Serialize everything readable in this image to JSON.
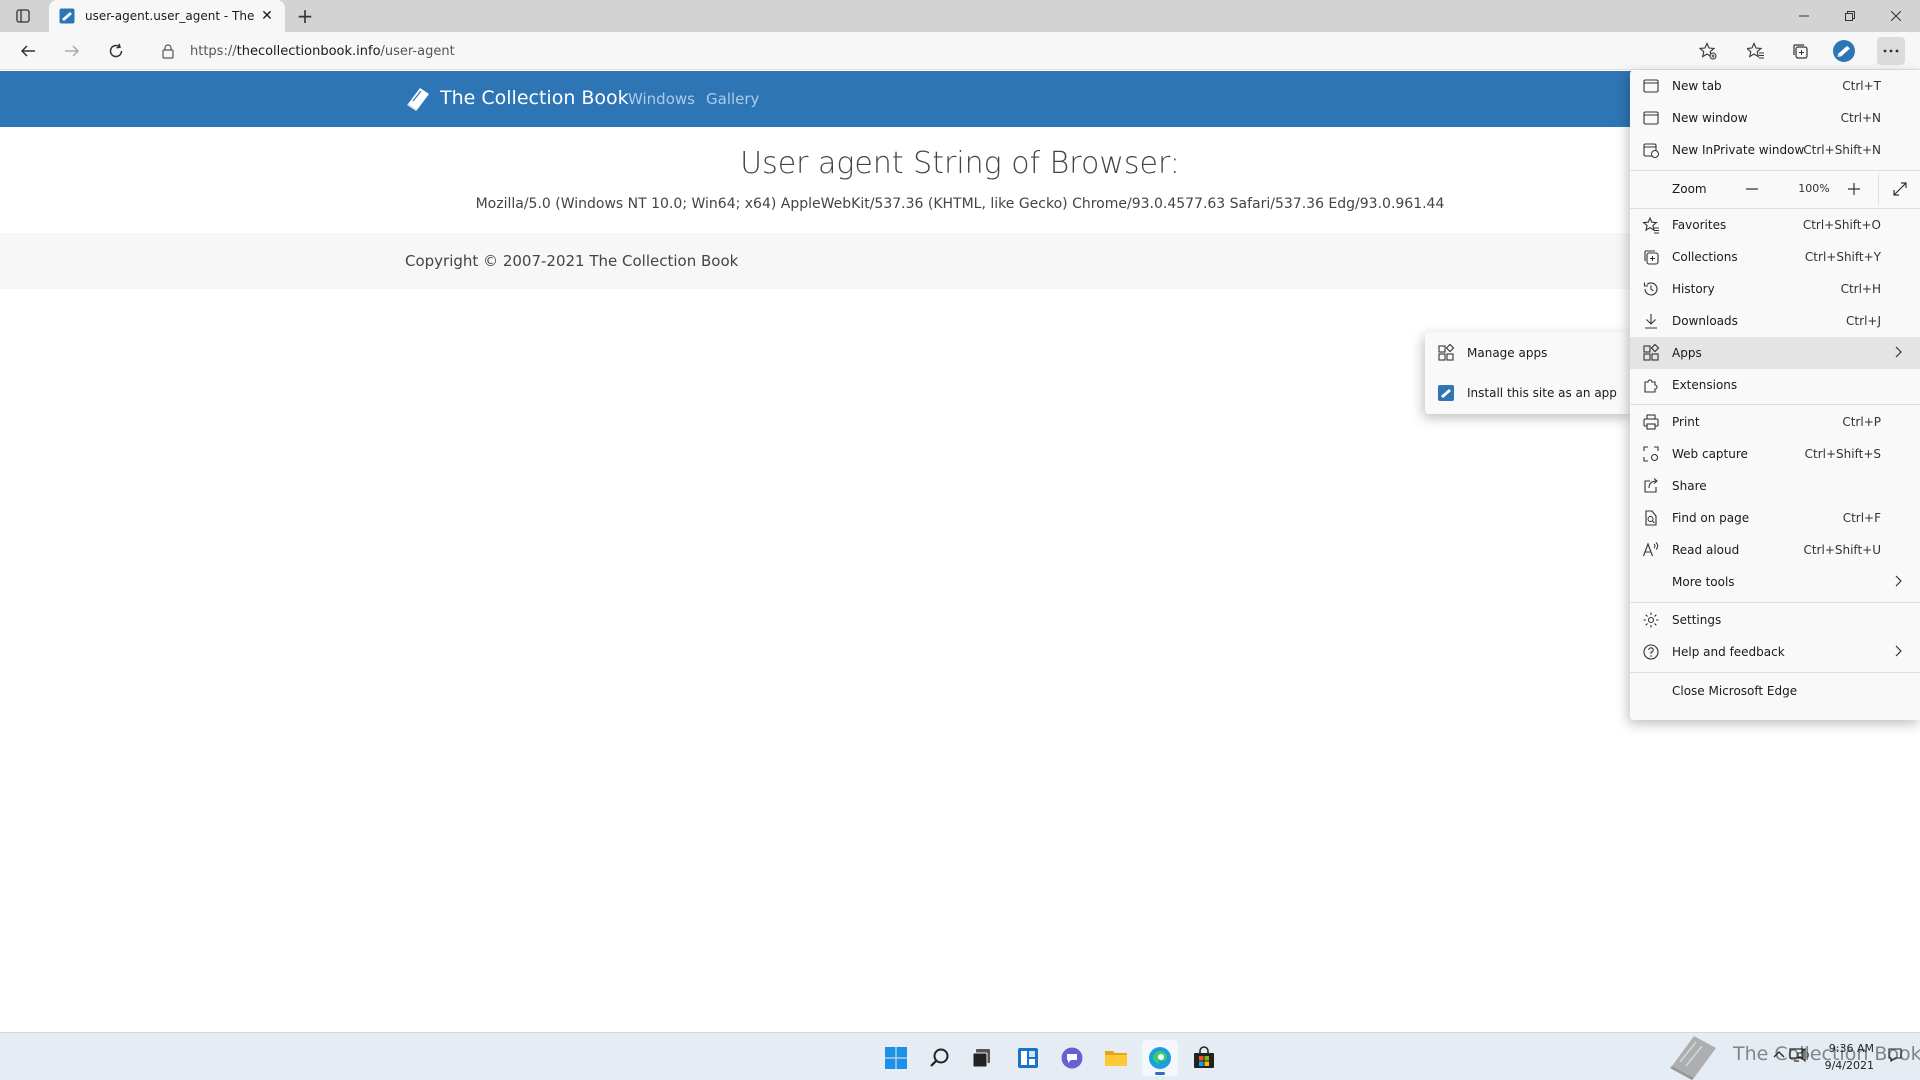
{
  "browser": {
    "tab": {
      "title": "user-agent.user_agent - The Coll",
      "close_glyph": "✕"
    },
    "new_tab_glyph": "+",
    "address": {
      "scheme": "https://",
      "host": "thecollectionbook.info",
      "path": "/user-agent"
    },
    "window_controls": {
      "minimize": "—",
      "restore": "❐",
      "close": "✕"
    }
  },
  "site": {
    "brand": "The Collection Book",
    "nav": [
      "Windows",
      "Gallery"
    ],
    "page_title": "User agent String of Browser:",
    "user_agent": "Mozilla/5.0 (Windows NT 10.0; Win64; x64) AppleWebKit/537.36 (KHTML, like Gecko) Chrome/93.0.4577.63 Safari/537.36 Edg/93.0.961.44",
    "copyright": "Copyright © 2007-2021 The Collection Book"
  },
  "menu": {
    "new_tab": {
      "label": "New tab",
      "shortcut": "Ctrl+T"
    },
    "new_window": {
      "label": "New window",
      "shortcut": "Ctrl+N"
    },
    "new_inprivate": {
      "label": "New InPrivate window",
      "shortcut": "Ctrl+Shift+N"
    },
    "zoom": {
      "label": "Zoom",
      "value": "100%",
      "minus": "—",
      "plus": "+"
    },
    "favorites": {
      "label": "Favorites",
      "shortcut": "Ctrl+Shift+O"
    },
    "collections": {
      "label": "Collections",
      "shortcut": "Ctrl+Shift+Y"
    },
    "history": {
      "label": "History",
      "shortcut": "Ctrl+H"
    },
    "downloads": {
      "label": "Downloads",
      "shortcut": "Ctrl+J"
    },
    "apps": {
      "label": "Apps"
    },
    "extensions": {
      "label": "Extensions"
    },
    "print": {
      "label": "Print",
      "shortcut": "Ctrl+P"
    },
    "web_capture": {
      "label": "Web capture",
      "shortcut": "Ctrl+Shift+S"
    },
    "share": {
      "label": "Share"
    },
    "find_on_page": {
      "label": "Find on page",
      "shortcut": "Ctrl+F"
    },
    "read_aloud": {
      "label": "Read aloud",
      "shortcut": "Ctrl+Shift+U"
    },
    "more_tools": {
      "label": "More tools"
    },
    "settings": {
      "label": "Settings"
    },
    "help": {
      "label": "Help and feedback"
    },
    "close_edge": {
      "label": "Close Microsoft Edge"
    }
  },
  "apps_submenu": {
    "manage": "Manage apps",
    "install": "Install this site as an app"
  },
  "taskbar": {
    "watermark": "The Collection Book",
    "time": "9:36 AM",
    "date": "9/4/2021",
    "accent": "#2f6fbd"
  },
  "colors": {
    "site_header": "#2e75b6",
    "nav_link": "#aecbea"
  }
}
